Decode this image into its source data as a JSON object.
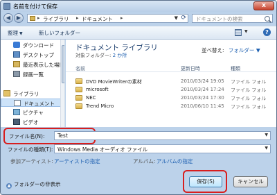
{
  "window": {
    "title": "名前を付けて保存",
    "close_label": "x"
  },
  "address": {
    "parts": [
      "ライブラリ",
      "ドキュメント"
    ],
    "search_placeholder": "ドキュメントの検索"
  },
  "toolbar": {
    "organize_label": "整理",
    "new_folder_label": "新しいフォルダー"
  },
  "nav": {
    "favorites": [
      "ダウンロード",
      "デスクトップ",
      "最近表示した場所",
      "録画一覧"
    ],
    "library_label": "ライブラリ",
    "libraries": [
      "ドキュメント",
      "ピクチャ",
      "ビデオ"
    ],
    "selected": "ドキュメント"
  },
  "content": {
    "library_title": "ドキュメント ライブラリ",
    "target_label": "対象フォルダー:",
    "target_link": "2 か所",
    "arrange_label": "並べ替え:",
    "arrange_value": "フォルダー",
    "columns": {
      "name": "名前",
      "date": "更新日時",
      "type": "種類"
    },
    "files": [
      {
        "name": "DVD MovieWriterの素材",
        "date": "2010/03/24 19:05",
        "type": "ファイル フォル"
      },
      {
        "name": "microsoft",
        "date": "2010/03/24 17:24",
        "type": "ファイル フォル"
      },
      {
        "name": "NEC",
        "date": "2010/03/24 17:30",
        "type": "ファイル フォル"
      },
      {
        "name": "Trend Micro",
        "date": "2010/06/10 11:45",
        "type": "ファイル フォル"
      }
    ]
  },
  "form": {
    "filename_label": "ファイル名(N):",
    "filename_value": "Test",
    "filetype_label": "ファイルの種類(T):",
    "filetype_value": "Windows Media オーディオ ファイル",
    "artist_label": "参加アーティスト:",
    "artist_link": "アーティストの指定",
    "album_label": "アルバム:",
    "album_link": "アルバムの指定",
    "hide_folders_label": "フォルダーの非表示",
    "save_label": "保存(S)",
    "cancel_label": "キャンセル"
  },
  "colors": {
    "highlight": "#d81e1e",
    "window_frame": "#bcd2ea",
    "link": "#1c5fb0"
  }
}
